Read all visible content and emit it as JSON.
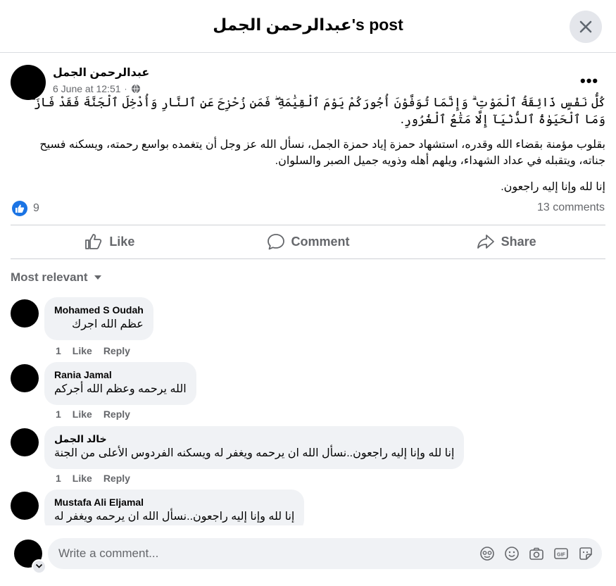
{
  "header": {
    "title": "عبدالرحمن الجمل's post"
  },
  "post": {
    "author": "عبدالرحمن الجمل",
    "date": "6 June at 12:51",
    "privacy_icon": "globe-icon",
    "verse": "كُلُّ نَفْسٍ ذَائِقَةُ ٱلْمَوْتِ ۗ وَإِنَّمَا تُوَفَّوْنَ أُجُورَكُمْ يَوْمَ ٱلْقِيَٰمَةِ ۖ فَمَن زُحْزِحَ عَنِ ٱلنَّارِ وَأُدْخِلَ ٱلْجَنَّةَ فَقَدْ فَازَ ۗ وَمَا ٱلْحَيَوٰةُ ٱلدُّنْيَآ إِلَّا مَتَٰعُ ٱلْغُرُورِ.",
    "paragraph1": "بقلوب مؤمنة بقضاء الله وقدره، استشهاد حمزة إياد حمزة الجمل، نسأل الله عز وجل أن يتغمده بواسع رحمته، ويسكنه فسيح جناته، ويتقبله في عداد الشهداء، ويلهم أهله وذويه جميل الصبر والسلوان.",
    "paragraph2": "إنا لله وإنا إليه راجعون.",
    "reaction_count": "9",
    "comments_count": "13 comments"
  },
  "actions": {
    "like": "Like",
    "comment": "Comment",
    "share": "Share"
  },
  "sort_label": "Most relevant",
  "comments": [
    {
      "name": "Mohamed S Oudah",
      "text": "عظم الله اجرك",
      "likes": "1",
      "like": "Like",
      "reply": "Reply"
    },
    {
      "name": "Rania Jamal",
      "text": "الله يرحمه وعظم الله أجركم",
      "likes": "1",
      "like": "Like",
      "reply": "Reply"
    },
    {
      "name": "خالد الجمل",
      "text": "إنا لله وإنا إليه راجعون..نسأل الله ان يرحمه ويغفر له ويسكنه الفردوس الأعلى من الجنة",
      "likes": "1",
      "like": "Like",
      "reply": "Reply"
    },
    {
      "name": "Mustafa Ali Eljamal",
      "text": "إنا لله وإنا إليه راجعون..نسأل الله ان يرحمه ويغفر له"
    }
  ],
  "composer": {
    "placeholder": "Write a comment...",
    "icons": [
      "avatar-sticker-icon",
      "emoji-icon",
      "camera-icon",
      "gif-icon",
      "sticker-icon"
    ]
  },
  "colors": {
    "accent": "#1b74e4",
    "bubble": "#f0f2f5",
    "secondary_text": "#65676b"
  }
}
